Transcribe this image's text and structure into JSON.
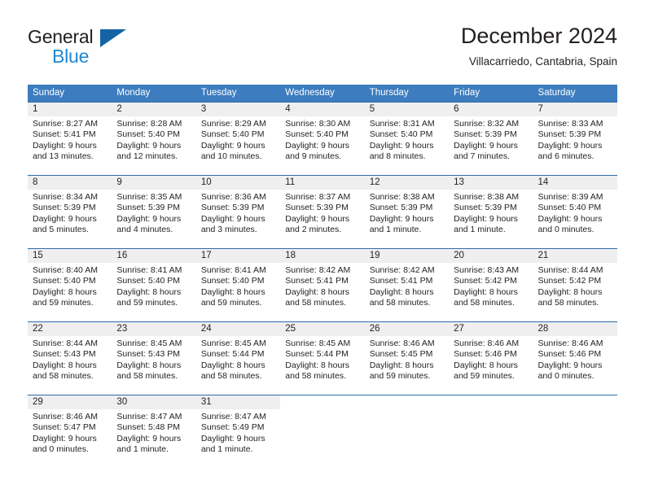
{
  "logo": {
    "word_top": "General",
    "word_bottom": "Blue",
    "triangle_icon": "triangle-icon",
    "color_dark": "#231f20",
    "color_blue": "#1e87d6",
    "color_triangle": "#1464a5"
  },
  "header": {
    "title": "December 2024",
    "subtitle": "Villacarriedo, Cantabria, Spain"
  },
  "colors": {
    "header_row_bg": "#3d7dbf",
    "row_border": "#2e6da9",
    "daynum_band_bg": "#efefef",
    "text": "#231f20"
  },
  "weekdays": [
    "Sunday",
    "Monday",
    "Tuesday",
    "Wednesday",
    "Thursday",
    "Friday",
    "Saturday"
  ],
  "weeks": [
    [
      {
        "day": "1",
        "sunrise": "Sunrise: 8:27 AM",
        "sunset": "Sunset: 5:41 PM",
        "daylight1": "Daylight: 9 hours",
        "daylight2": "and 13 minutes."
      },
      {
        "day": "2",
        "sunrise": "Sunrise: 8:28 AM",
        "sunset": "Sunset: 5:40 PM",
        "daylight1": "Daylight: 9 hours",
        "daylight2": "and 12 minutes."
      },
      {
        "day": "3",
        "sunrise": "Sunrise: 8:29 AM",
        "sunset": "Sunset: 5:40 PM",
        "daylight1": "Daylight: 9 hours",
        "daylight2": "and 10 minutes."
      },
      {
        "day": "4",
        "sunrise": "Sunrise: 8:30 AM",
        "sunset": "Sunset: 5:40 PM",
        "daylight1": "Daylight: 9 hours",
        "daylight2": "and 9 minutes."
      },
      {
        "day": "5",
        "sunrise": "Sunrise: 8:31 AM",
        "sunset": "Sunset: 5:40 PM",
        "daylight1": "Daylight: 9 hours",
        "daylight2": "and 8 minutes."
      },
      {
        "day": "6",
        "sunrise": "Sunrise: 8:32 AM",
        "sunset": "Sunset: 5:39 PM",
        "daylight1": "Daylight: 9 hours",
        "daylight2": "and 7 minutes."
      },
      {
        "day": "7",
        "sunrise": "Sunrise: 8:33 AM",
        "sunset": "Sunset: 5:39 PM",
        "daylight1": "Daylight: 9 hours",
        "daylight2": "and 6 minutes."
      }
    ],
    [
      {
        "day": "8",
        "sunrise": "Sunrise: 8:34 AM",
        "sunset": "Sunset: 5:39 PM",
        "daylight1": "Daylight: 9 hours",
        "daylight2": "and 5 minutes."
      },
      {
        "day": "9",
        "sunrise": "Sunrise: 8:35 AM",
        "sunset": "Sunset: 5:39 PM",
        "daylight1": "Daylight: 9 hours",
        "daylight2": "and 4 minutes."
      },
      {
        "day": "10",
        "sunrise": "Sunrise: 8:36 AM",
        "sunset": "Sunset: 5:39 PM",
        "daylight1": "Daylight: 9 hours",
        "daylight2": "and 3 minutes."
      },
      {
        "day": "11",
        "sunrise": "Sunrise: 8:37 AM",
        "sunset": "Sunset: 5:39 PM",
        "daylight1": "Daylight: 9 hours",
        "daylight2": "and 2 minutes."
      },
      {
        "day": "12",
        "sunrise": "Sunrise: 8:38 AM",
        "sunset": "Sunset: 5:39 PM",
        "daylight1": "Daylight: 9 hours",
        "daylight2": "and 1 minute."
      },
      {
        "day": "13",
        "sunrise": "Sunrise: 8:38 AM",
        "sunset": "Sunset: 5:39 PM",
        "daylight1": "Daylight: 9 hours",
        "daylight2": "and 1 minute."
      },
      {
        "day": "14",
        "sunrise": "Sunrise: 8:39 AM",
        "sunset": "Sunset: 5:40 PM",
        "daylight1": "Daylight: 9 hours",
        "daylight2": "and 0 minutes."
      }
    ],
    [
      {
        "day": "15",
        "sunrise": "Sunrise: 8:40 AM",
        "sunset": "Sunset: 5:40 PM",
        "daylight1": "Daylight: 8 hours",
        "daylight2": "and 59 minutes."
      },
      {
        "day": "16",
        "sunrise": "Sunrise: 8:41 AM",
        "sunset": "Sunset: 5:40 PM",
        "daylight1": "Daylight: 8 hours",
        "daylight2": "and 59 minutes."
      },
      {
        "day": "17",
        "sunrise": "Sunrise: 8:41 AM",
        "sunset": "Sunset: 5:40 PM",
        "daylight1": "Daylight: 8 hours",
        "daylight2": "and 59 minutes."
      },
      {
        "day": "18",
        "sunrise": "Sunrise: 8:42 AM",
        "sunset": "Sunset: 5:41 PM",
        "daylight1": "Daylight: 8 hours",
        "daylight2": "and 58 minutes."
      },
      {
        "day": "19",
        "sunrise": "Sunrise: 8:42 AM",
        "sunset": "Sunset: 5:41 PM",
        "daylight1": "Daylight: 8 hours",
        "daylight2": "and 58 minutes."
      },
      {
        "day": "20",
        "sunrise": "Sunrise: 8:43 AM",
        "sunset": "Sunset: 5:42 PM",
        "daylight1": "Daylight: 8 hours",
        "daylight2": "and 58 minutes."
      },
      {
        "day": "21",
        "sunrise": "Sunrise: 8:44 AM",
        "sunset": "Sunset: 5:42 PM",
        "daylight1": "Daylight: 8 hours",
        "daylight2": "and 58 minutes."
      }
    ],
    [
      {
        "day": "22",
        "sunrise": "Sunrise: 8:44 AM",
        "sunset": "Sunset: 5:43 PM",
        "daylight1": "Daylight: 8 hours",
        "daylight2": "and 58 minutes."
      },
      {
        "day": "23",
        "sunrise": "Sunrise: 8:45 AM",
        "sunset": "Sunset: 5:43 PM",
        "daylight1": "Daylight: 8 hours",
        "daylight2": "and 58 minutes."
      },
      {
        "day": "24",
        "sunrise": "Sunrise: 8:45 AM",
        "sunset": "Sunset: 5:44 PM",
        "daylight1": "Daylight: 8 hours",
        "daylight2": "and 58 minutes."
      },
      {
        "day": "25",
        "sunrise": "Sunrise: 8:45 AM",
        "sunset": "Sunset: 5:44 PM",
        "daylight1": "Daylight: 8 hours",
        "daylight2": "and 58 minutes."
      },
      {
        "day": "26",
        "sunrise": "Sunrise: 8:46 AM",
        "sunset": "Sunset: 5:45 PM",
        "daylight1": "Daylight: 8 hours",
        "daylight2": "and 59 minutes."
      },
      {
        "day": "27",
        "sunrise": "Sunrise: 8:46 AM",
        "sunset": "Sunset: 5:46 PM",
        "daylight1": "Daylight: 8 hours",
        "daylight2": "and 59 minutes."
      },
      {
        "day": "28",
        "sunrise": "Sunrise: 8:46 AM",
        "sunset": "Sunset: 5:46 PM",
        "daylight1": "Daylight: 9 hours",
        "daylight2": "and 0 minutes."
      }
    ],
    [
      {
        "day": "29",
        "sunrise": "Sunrise: 8:46 AM",
        "sunset": "Sunset: 5:47 PM",
        "daylight1": "Daylight: 9 hours",
        "daylight2": "and 0 minutes."
      },
      {
        "day": "30",
        "sunrise": "Sunrise: 8:47 AM",
        "sunset": "Sunset: 5:48 PM",
        "daylight1": "Daylight: 9 hours",
        "daylight2": "and 1 minute."
      },
      {
        "day": "31",
        "sunrise": "Sunrise: 8:47 AM",
        "sunset": "Sunset: 5:49 PM",
        "daylight1": "Daylight: 9 hours",
        "daylight2": "and 1 minute."
      },
      {
        "day": "",
        "sunrise": "",
        "sunset": "",
        "daylight1": "",
        "daylight2": ""
      },
      {
        "day": "",
        "sunrise": "",
        "sunset": "",
        "daylight1": "",
        "daylight2": ""
      },
      {
        "day": "",
        "sunrise": "",
        "sunset": "",
        "daylight1": "",
        "daylight2": ""
      },
      {
        "day": "",
        "sunrise": "",
        "sunset": "",
        "daylight1": "",
        "daylight2": ""
      }
    ]
  ]
}
